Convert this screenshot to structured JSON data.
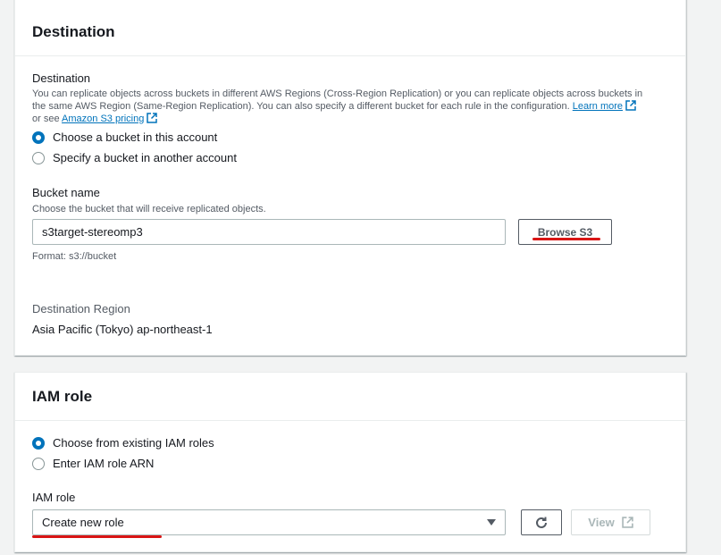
{
  "destination_panel": {
    "title": "Destination",
    "section_label": "Destination",
    "description_line1": "You can replicate objects across buckets in different AWS Regions (Cross-Region Replication) or you can replicate objects across buckets in",
    "description_line2": "the same AWS Region (Same-Region Replication). You can also specify a different bucket for each rule in the configuration.",
    "learn_more_link": "Learn more",
    "or_see_text": "or see",
    "pricing_link": "Amazon S3 pricing",
    "options": [
      {
        "label": "Choose a bucket in this account",
        "checked": true
      },
      {
        "label": "Specify a bucket in another account",
        "checked": false
      }
    ],
    "bucket_name_label": "Bucket name",
    "bucket_name_description": "Choose the bucket that will receive replicated objects.",
    "bucket_name_value": "s3target-stereomp3",
    "browse_button": "Browse S3",
    "format_hint": "Format: s3://bucket",
    "region_label": "Destination Region",
    "region_value": "Asia Pacific (Tokyo) ap-northeast-1"
  },
  "iam_panel": {
    "title": "IAM role",
    "options": [
      {
        "label": "Choose from existing IAM roles",
        "checked": true
      },
      {
        "label": "Enter IAM role ARN",
        "checked": false
      }
    ],
    "role_label": "IAM role",
    "role_select_value": "Create new role",
    "view_button": "View"
  },
  "colors": {
    "accent": "#0073bb",
    "annotation_red": "#d91515",
    "text": "#16191f",
    "muted": "#545b64"
  },
  "icons": [
    "external-link-icon",
    "refresh-icon",
    "caret-down-icon"
  ]
}
